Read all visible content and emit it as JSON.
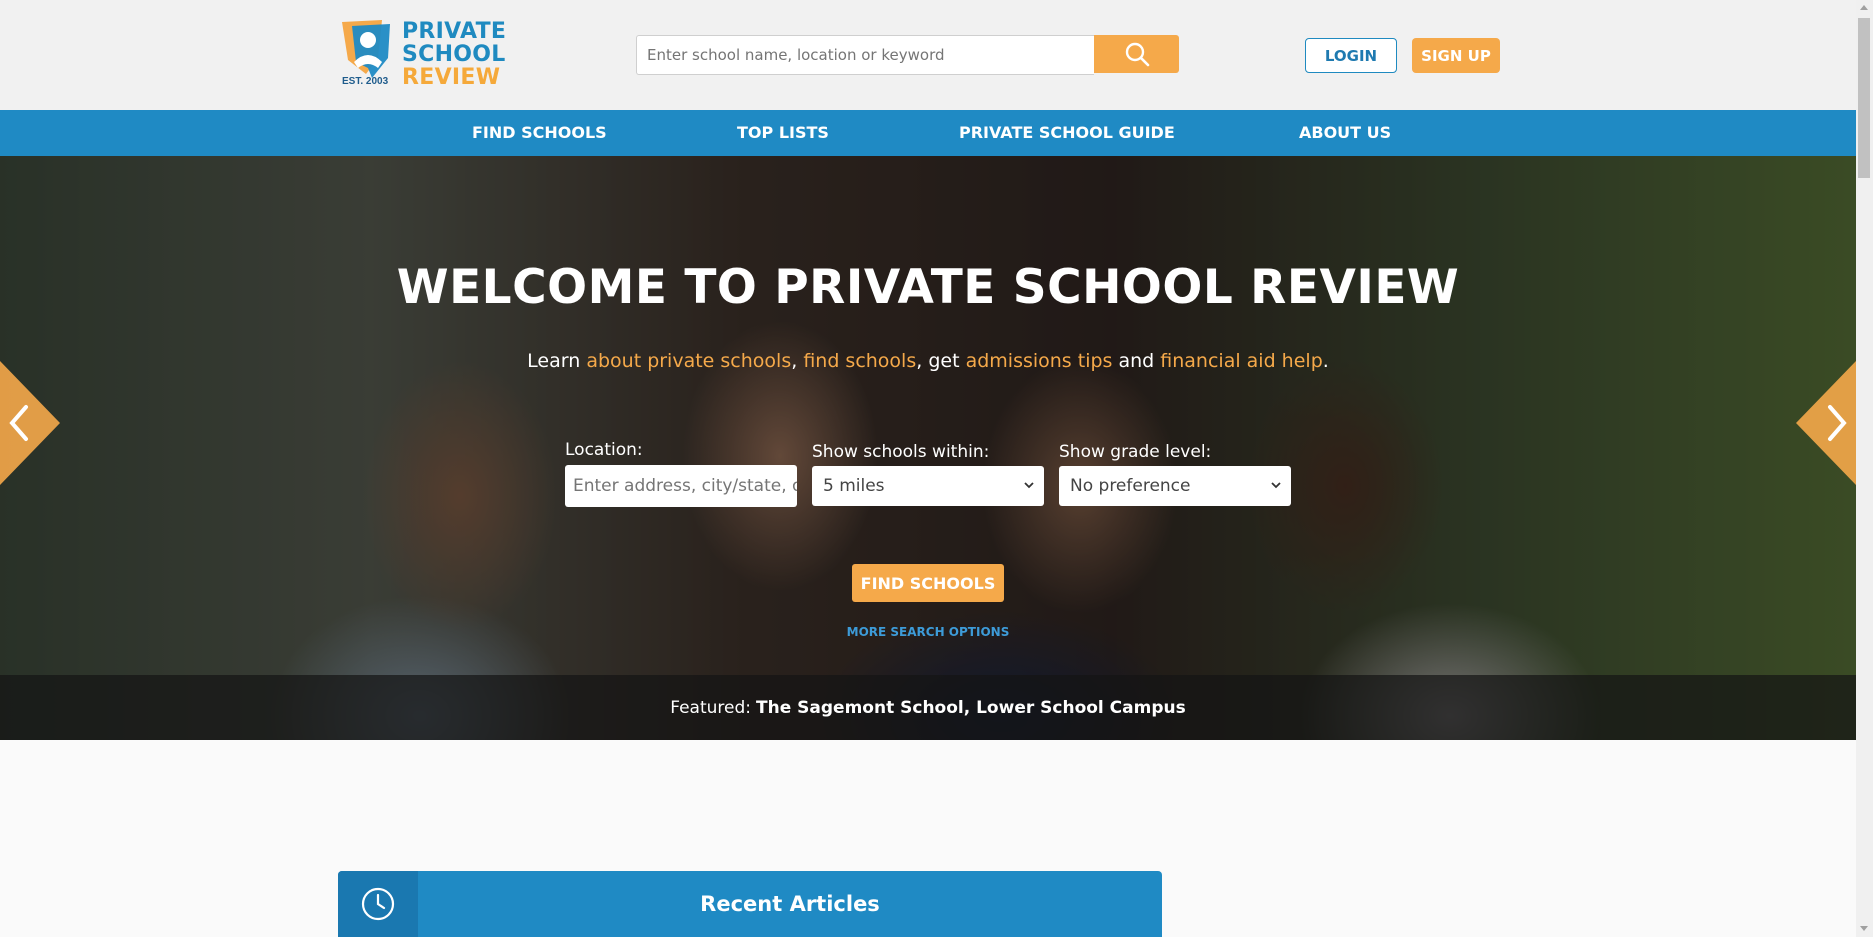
{
  "brand": {
    "logo_line1": "PRIVATE",
    "logo_line2": "SCHOOL",
    "logo_line3": "REVIEW",
    "logo_est": "EST. 2003",
    "color_primary": "#1f8ac4",
    "color_accent": "#f5a94a"
  },
  "header": {
    "search_placeholder": "Enter school name, location or keyword",
    "search_icon": "search-icon",
    "login_label": "LOGIN",
    "signup_label": "SIGN UP"
  },
  "nav": {
    "items": [
      {
        "label": "FIND SCHOOLS"
      },
      {
        "label": "TOP LISTS"
      },
      {
        "label": "PRIVATE SCHOOL GUIDE"
      },
      {
        "label": "ABOUT US"
      }
    ]
  },
  "hero": {
    "title": "WELCOME TO PRIVATE SCHOOL REVIEW",
    "subtitle": {
      "t1": "Learn ",
      "l1": "about private schools",
      "t2": ", ",
      "l2": "find schools",
      "t3": ", get ",
      "l3": "admissions tips",
      "t4": " and ",
      "l4": "financial aid help",
      "t5": "."
    },
    "location_label": "Location:",
    "location_placeholder": "Enter address, city/state, or zip",
    "within_label": "Show schools within:",
    "within_value": "5 miles",
    "grade_label": "Show grade level:",
    "grade_value": "No preference",
    "find_button": "FIND SCHOOLS",
    "more_options": "MORE SEARCH OPTIONS",
    "featured_prefix": "Featured:",
    "featured_name": "The Sagemont School, Lower School Campus",
    "prev_icon": "chevron-left-icon",
    "next_icon": "chevron-right-icon"
  },
  "articles": {
    "title": "Recent Articles",
    "icon": "clock-icon"
  }
}
